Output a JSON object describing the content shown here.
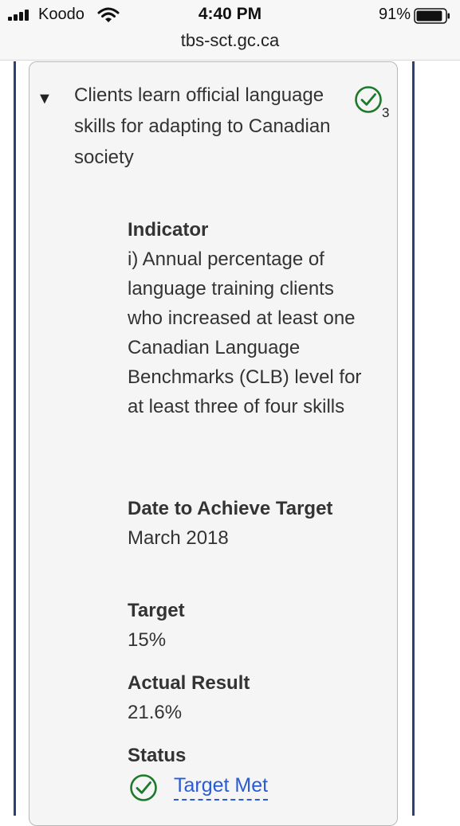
{
  "status_bar": {
    "carrier": "Koodo",
    "time": "4:40 PM",
    "battery_percent": "91%",
    "battery_level": 0.91,
    "icons": [
      "signal-icon",
      "wifi-icon",
      "battery-icon"
    ]
  },
  "browser": {
    "url": "tbs-sct.gc.ca"
  },
  "result_card": {
    "expand_icon": "▼",
    "title": "Clients learn official language skills for adapting to Canadian society",
    "status_icon": "check-circle-icon",
    "indicator_count": "3",
    "indicator_label": "Indicator",
    "indicator_text": "i) Annual percentage of language training clients who increased at least one Canadian Language Benchmarks (CLB) level for at least three of four skills",
    "date_label": "Date to Achieve Target",
    "date_value": "March 2018",
    "target_label": "Target",
    "target_value": "15%",
    "actual_label": "Actual Result",
    "actual_value": "21.6%",
    "status_label": "Status",
    "status_value": "Target Met"
  },
  "colors": {
    "check_green": "#1c7a2a",
    "link_blue": "#2a5bd7",
    "rail_navy": "#2b4170",
    "card_bg": "#f5f5f5"
  }
}
